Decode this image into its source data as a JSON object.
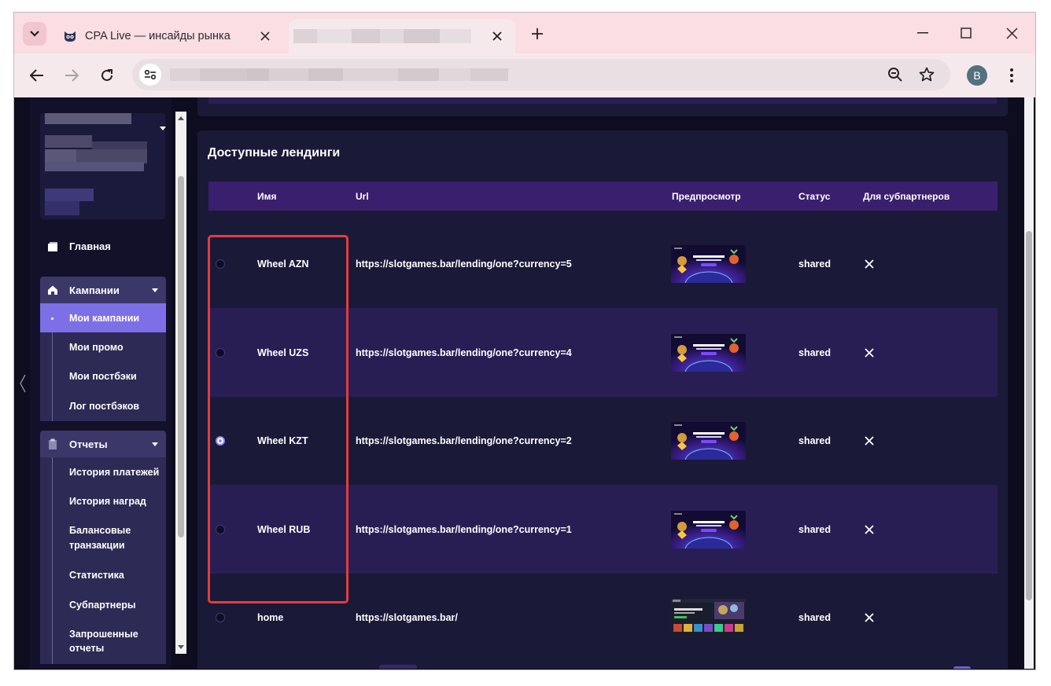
{
  "browser": {
    "tabs": [
      {
        "title": "CPA Live — инсайды рынка",
        "active": false,
        "favicon": "cat-icon"
      },
      {
        "title": "",
        "active": true,
        "blurred": true
      }
    ],
    "profile_initial": "B",
    "address_blurred": true
  },
  "colors": {
    "accent": "#7d6fe6",
    "highlight": "#e23d3d",
    "table_header": "#3a1f6e",
    "row_alt": "#291e54",
    "panel": "#1b1938"
  },
  "sidebar": {
    "home_label": "Главная",
    "groups": [
      {
        "label": "Кампании",
        "items": [
          {
            "label": "Мои кампании",
            "active": true
          },
          {
            "label": "Мои промо"
          },
          {
            "label": "Мои постбэки"
          },
          {
            "label": "Лог постбэков"
          }
        ]
      },
      {
        "label": "Отчеты",
        "items": [
          {
            "label": "История платежей"
          },
          {
            "label": "История наград"
          },
          {
            "label": "Балансовые транзакции"
          },
          {
            "label": "Статистика"
          },
          {
            "label": "Субпартнеры"
          },
          {
            "label": "Запрошенные отчеты"
          }
        ]
      }
    ]
  },
  "landings": {
    "title": "Доступные лендинги",
    "columns": [
      "Имя",
      "Url",
      "Предпросмотр",
      "Статус",
      "Для субпартнеров"
    ],
    "rows": [
      {
        "name": "Wheel AZN",
        "url": "https://slotgames.bar/lending/one?currency=5",
        "status": "shared",
        "selected": false,
        "preview": "wheel-bonus-preview",
        "subpartners": "close-icon"
      },
      {
        "name": "Wheel UZS",
        "url": "https://slotgames.bar/lending/one?currency=4",
        "status": "shared",
        "selected": false,
        "preview": "wheel-bonus-preview",
        "subpartners": "close-icon"
      },
      {
        "name": "Wheel KZT",
        "url": "https://slotgames.bar/lending/one?currency=2",
        "status": "shared",
        "selected": true,
        "preview": "wheel-bonus-preview",
        "subpartners": "close-icon"
      },
      {
        "name": "Wheel RUB",
        "url": "https://slotgames.bar/lending/one?currency=1",
        "status": "shared",
        "selected": false,
        "preview": "wheel-bonus-preview",
        "subpartners": "close-icon"
      },
      {
        "name": "home",
        "url": "https://slotgames.bar/",
        "status": "shared",
        "selected": false,
        "preview": "casino-home-preview",
        "subpartners": "close-icon"
      }
    ]
  }
}
